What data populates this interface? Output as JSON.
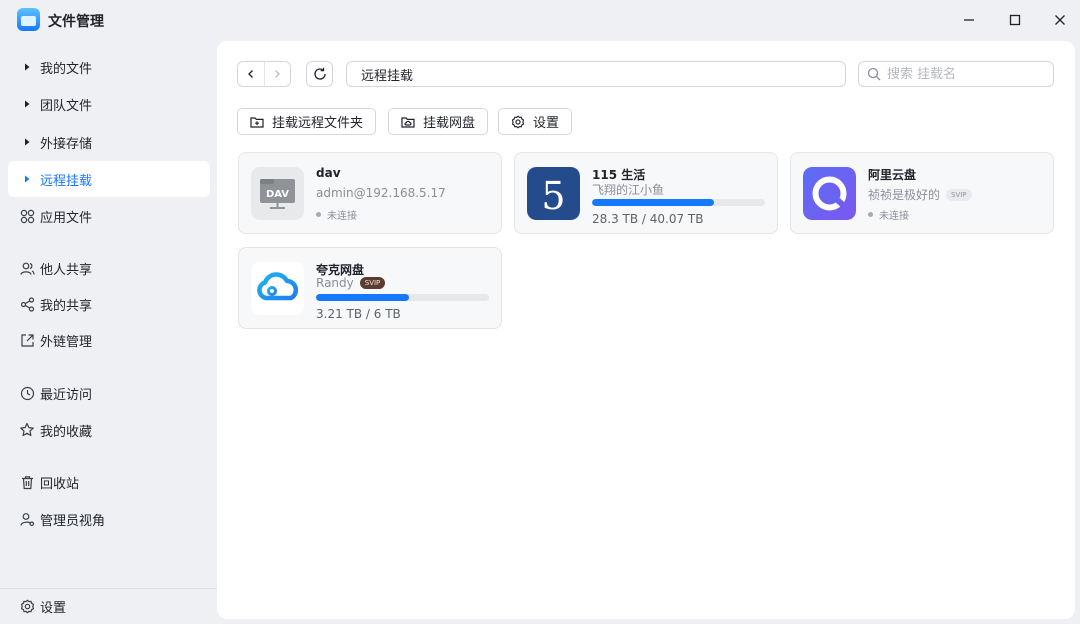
{
  "window": {
    "title": "文件管理",
    "controls": [
      "minimize-icon",
      "maximize-icon",
      "close-icon"
    ]
  },
  "sidebar": {
    "items": [
      {
        "label": "我的文件",
        "icon": "caret-right-icon",
        "active": false
      },
      {
        "label": "团队文件",
        "icon": "caret-right-icon",
        "active": false
      },
      {
        "label": "外接存储",
        "icon": "caret-right-icon",
        "active": false
      },
      {
        "label": "远程挂载",
        "icon": "caret-right-icon",
        "active": true
      },
      {
        "label": "应用文件",
        "icon": "apps-grid-icon",
        "active": false
      },
      {
        "label": "他人共享",
        "icon": "users-icon",
        "active": false
      },
      {
        "label": "我的共享",
        "icon": "share-icon",
        "active": false
      },
      {
        "label": "外链管理",
        "icon": "external-link-icon",
        "active": false
      },
      {
        "label": "最近访问",
        "icon": "clock-icon",
        "active": false
      },
      {
        "label": "我的收藏",
        "icon": "star-icon",
        "active": false
      },
      {
        "label": "回收站",
        "icon": "trash-icon",
        "active": false
      },
      {
        "label": "管理员视角",
        "icon": "admin-user-icon",
        "active": false
      }
    ],
    "footer_label": "设置"
  },
  "toolbar": {
    "path": "远程挂载",
    "search_placeholder": "搜索 挂载名"
  },
  "actions": {
    "mount_folder": "挂载远程文件夹",
    "mount_cloud": "挂载网盘",
    "settings": "设置"
  },
  "mounts": [
    {
      "name": "dav",
      "sub": "admin@192.168.5.17",
      "status": "未连接",
      "logo": "dav-drive-icon"
    },
    {
      "name": "115 生活",
      "sub": "飞翔的江小鱼",
      "usage_fraction": 0.706,
      "capacity": "28.3 TB / 40.07 TB",
      "logo": "115-logo-icon"
    },
    {
      "name": "阿里云盘",
      "sub": "祯祯是极好的",
      "badge": "SVIP",
      "status": "未连接",
      "logo": "aliyun-drive-logo-icon"
    },
    {
      "name": "夸克网盘",
      "sub": "Randy",
      "badge": "SVIP",
      "usage_fraction": 0.535,
      "capacity": "3.21 TB / 6 TB",
      "logo": "quark-cloud-logo-icon"
    }
  ],
  "colors": {
    "accent": "#1677ff",
    "background": "#eef0f3",
    "panel": "#ffffff",
    "card": "#f7f8fa"
  }
}
